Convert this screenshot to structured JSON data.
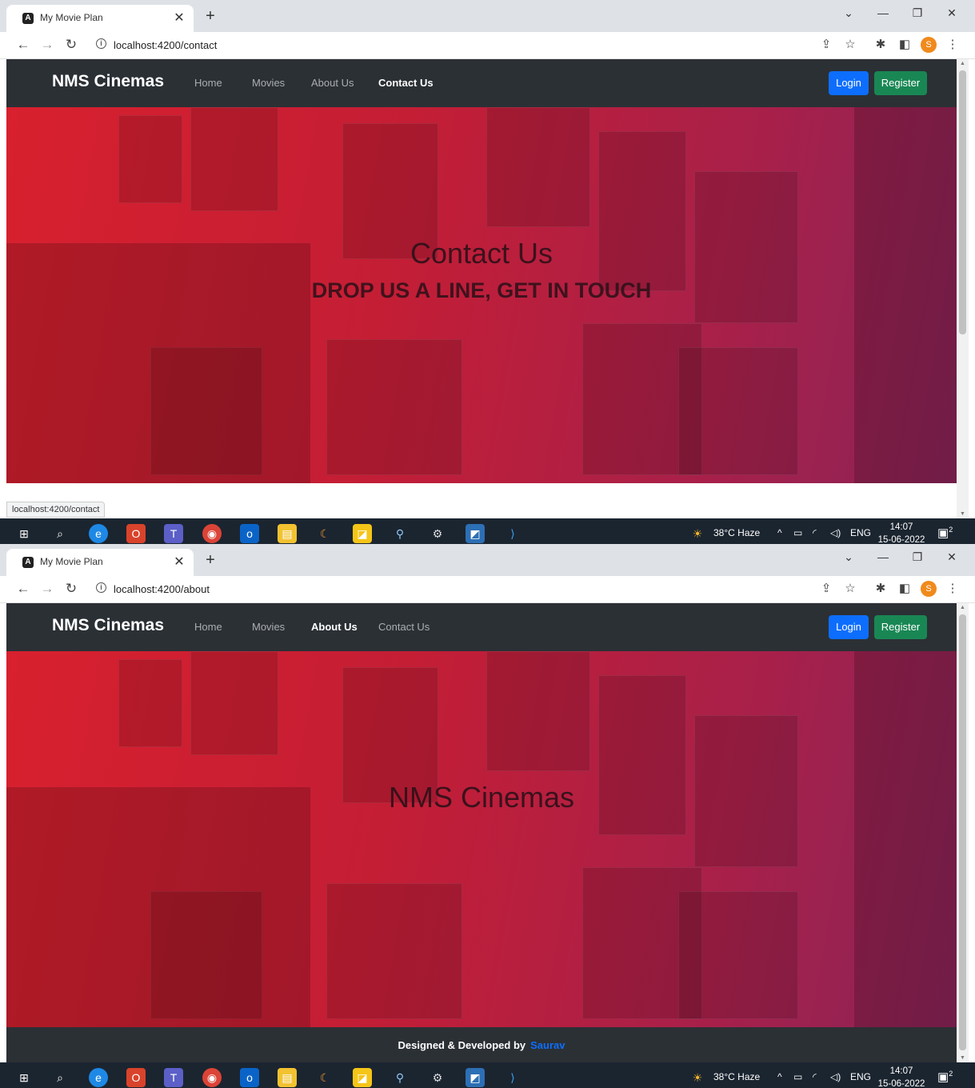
{
  "screens": [
    {
      "tab_title": "My Movie Plan",
      "url": "localhost:4200/contact",
      "active_nav": "contact",
      "hero_title": "Contact Us",
      "hero_subtitle": "DROP US A LINE, GET IN TOUCH",
      "status_url": "localhost:4200/contact"
    },
    {
      "tab_title": "My Movie Plan",
      "url": "localhost:4200/about",
      "active_nav": "about",
      "hero_title": "NMS Cinemas",
      "footer_text": "Designed & Developed by",
      "footer_author": "Saurav"
    }
  ],
  "navbar": {
    "brand": "NMS Cinemas",
    "links": {
      "home": "Home",
      "movies": "Movies",
      "about": "About Us",
      "contact": "Contact Us"
    },
    "login": "Login",
    "register": "Register"
  },
  "browser": {
    "new_tab": "+",
    "profile_initial": "S"
  },
  "taskbar": {
    "weather": "38°C Haze",
    "language": "ENG",
    "time": "14:07",
    "date": "15-06-2022",
    "notifications": "2"
  },
  "colors": {
    "navbar_bg": "#2b3035",
    "login_btn": "#0d6efd",
    "register_btn": "#198754",
    "hero_red": "#d8202e",
    "author_link": "#0d6efd"
  }
}
